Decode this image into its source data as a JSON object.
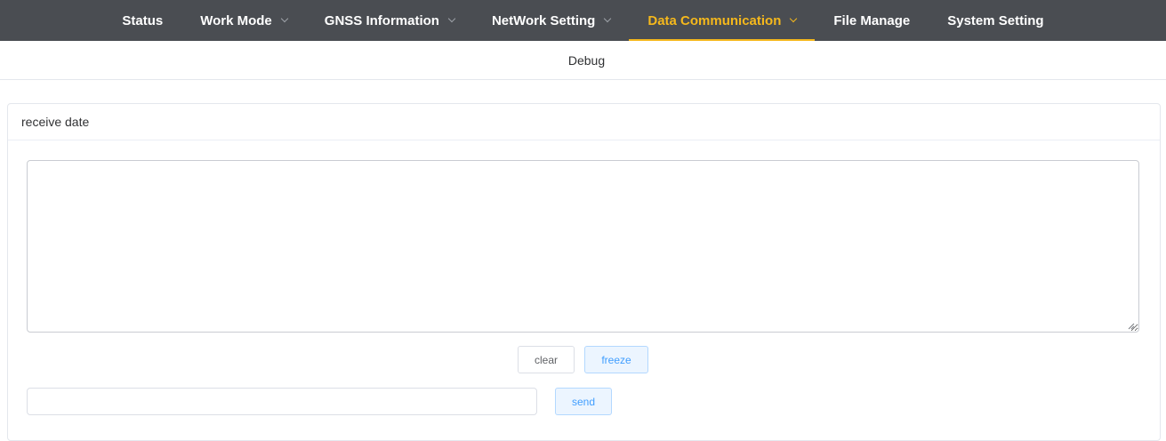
{
  "nav": {
    "items": [
      {
        "label": "Status",
        "has_dropdown": false,
        "active": false
      },
      {
        "label": "Work Mode",
        "has_dropdown": true,
        "active": false
      },
      {
        "label": "GNSS Information",
        "has_dropdown": true,
        "active": false
      },
      {
        "label": "NetWork Setting",
        "has_dropdown": true,
        "active": false
      },
      {
        "label": "Data Communication",
        "has_dropdown": true,
        "active": true
      },
      {
        "label": "File Manage",
        "has_dropdown": false,
        "active": false
      },
      {
        "label": "System Setting",
        "has_dropdown": false,
        "active": false
      }
    ],
    "active_color": "#f5b81c",
    "background": "#4a4d52"
  },
  "subnav": {
    "items": [
      {
        "label": "Debug"
      }
    ]
  },
  "receive_card": {
    "title": "receive date",
    "textarea_value": "",
    "clear_label": "clear",
    "freeze_label": "freeze"
  },
  "send": {
    "input_value": "",
    "send_label": "send"
  },
  "icons": {
    "dropdown": "chevron-down-icon",
    "resize": "resize-grip-icon"
  }
}
